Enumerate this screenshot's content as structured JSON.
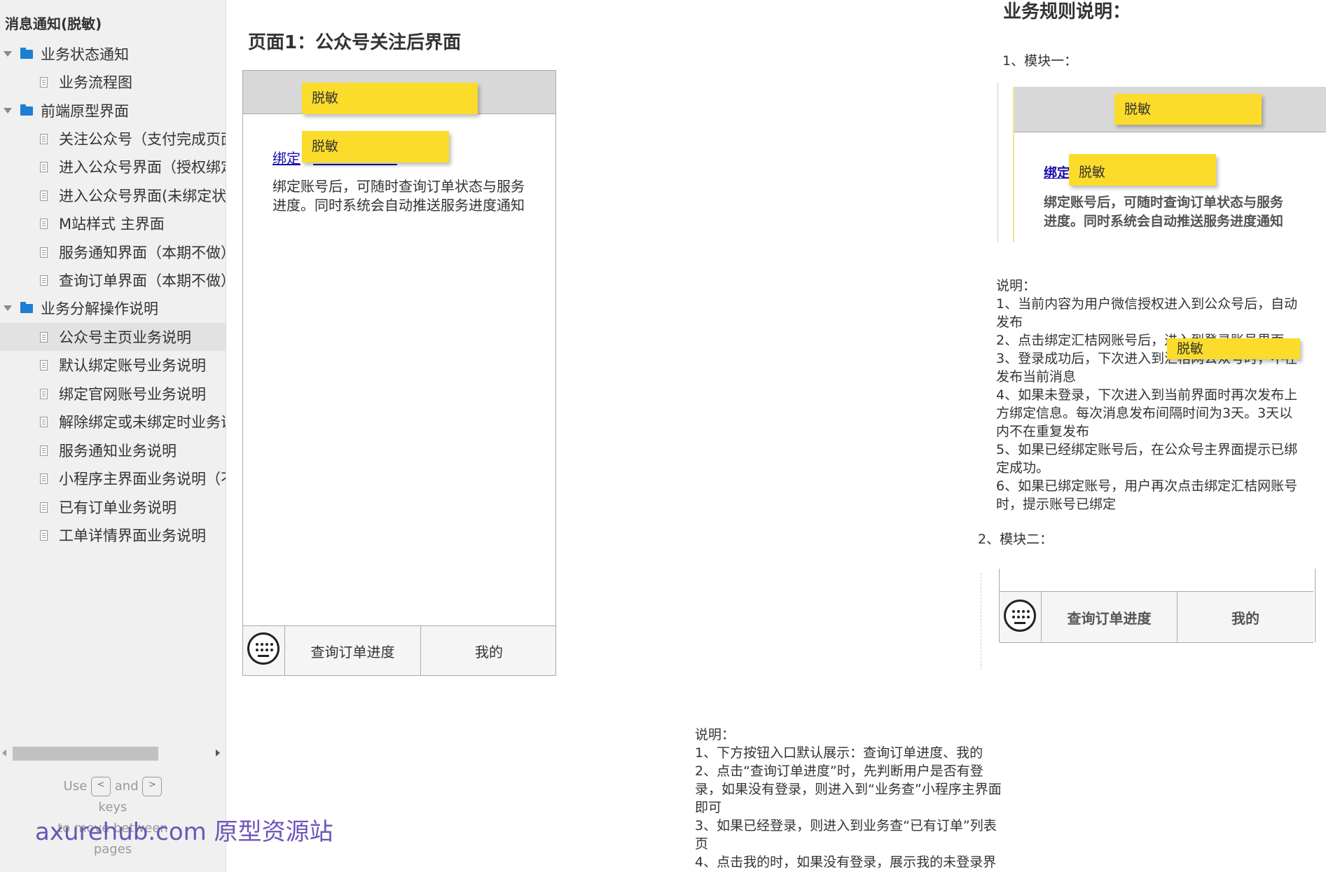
{
  "sidebar": {
    "title": "消息通知(脱敏)",
    "folders": [
      {
        "label": "业务状态通知"
      },
      {
        "label": "前端原型界面"
      },
      {
        "label": "业务分解操作说明"
      }
    ],
    "pages": [
      {
        "label": "业务流程图"
      },
      {
        "label": "关注公众号（支付完成页面"
      },
      {
        "label": "进入公众号界面（授权绑定"
      },
      {
        "label": "进入公众号界面(未绑定状"
      },
      {
        "label": "M站样式 主界面"
      },
      {
        "label": "服务通知界面（本期不做）"
      },
      {
        "label": "查询订单界面（本期不做）"
      },
      {
        "label": "公众号主页业务说明"
      },
      {
        "label": "默认绑定账号业务说明"
      },
      {
        "label": "绑定官网账号业务说明"
      },
      {
        "label": "解除绑定或未绑定时业务说"
      },
      {
        "label": "服务通知业务说明"
      },
      {
        "label": "小程序主界面业务说明（不"
      },
      {
        "label": "已有订单业务说明"
      },
      {
        "label": "工单详情界面业务说明"
      }
    ],
    "selected": "公众号主页业务说明",
    "nav_hint": {
      "use": "Use",
      "and": "and",
      "keys": "keys",
      "rest1": "to move between",
      "rest2": "pages",
      "prev_key": "<",
      "next_key": ">"
    },
    "watermark": "axurehub.com 原型资源站"
  },
  "page1": {
    "title": "页面1：公众号关注后界面",
    "sticky_top": "脱敏",
    "sticky_link": "脱敏",
    "link_text": "绑定",
    "desc_line1": "绑定账号后，可随时查询订单状态与服务",
    "desc_line2": "进度。同时系统会自动推送服务进度通知",
    "tabs": {
      "query": "查询订单进度",
      "mine": "我的"
    }
  },
  "rules": {
    "title": "业务规则说明：",
    "module1": {
      "heading": "1、模块一：",
      "sticky_top": "脱敏",
      "sticky_link": "脱敏",
      "sticky_note": "脱敏",
      "link_text": "绑定",
      "desc_line1": "绑定账号后，可随时查询订单状态与服务",
      "desc_line2": "进度。同时系统会自动推送服务进度通知",
      "notes": [
        "说明：",
        "1、当前内容为用户微信授权进入到公众号后，自动",
        "发布",
        "2、点击绑定汇桔网账号后，进入到登录账号界面",
        "3、登录成功后，下次进入到汇桔网公众号时，不在",
        "发布当前消息",
        "4、如果未登录，下次进入到当前界面时再次发布上",
        "方绑定信息。每次消息发布间隔时间为3天。3天以",
        "内不在重复发布",
        "5、如果已经绑定账号后，在公众号主界面提示已绑",
        "定成功。",
        "6、如果已绑定账号，用户再次点击绑定汇桔网账号",
        "时，提示账号已绑定"
      ]
    },
    "module2": {
      "heading": "2、模块二：",
      "tabs": {
        "query": "查询订单进度",
        "mine": "我的"
      },
      "notes": [
        "说明：",
        "1、下方按钮入口默认展示：查询订单进度、我的",
        "2、点击“查询订单进度”时，先判断用户是否有登",
        "录，如果没有登录，则进入到“业务查”小程序主界面",
        "即可",
        "3、如果已经登录，则进入到业务查“已有订单”列表",
        "页",
        "4、点击我的时，如果没有登录，展示我的未登录界"
      ]
    }
  }
}
